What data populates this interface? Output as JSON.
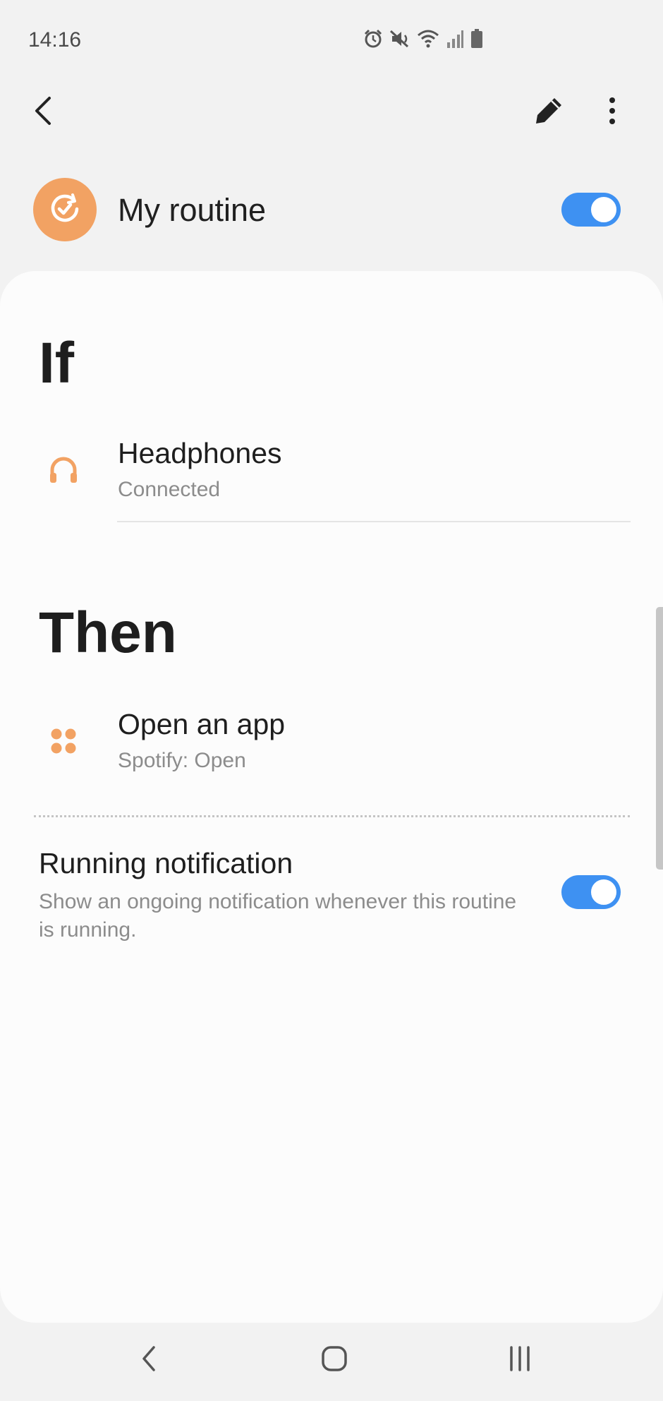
{
  "status_bar": {
    "time": "14:16",
    "icons": [
      "alarm-icon",
      "mute-icon",
      "wifi-icon",
      "signal-icon",
      "battery-icon"
    ]
  },
  "toolbar": {
    "back_icon": "chevron-left-icon",
    "edit_icon": "pencil-icon",
    "more_icon": "more-vertical-icon"
  },
  "routine": {
    "name": "My routine",
    "enabled": true,
    "icon": "routine-check-icon",
    "accent_color": "#f2a263"
  },
  "if_section": {
    "title": "If",
    "items": [
      {
        "icon": "headphones-icon",
        "title": "Headphones",
        "subtitle": "Connected"
      }
    ]
  },
  "then_section": {
    "title": "Then",
    "items": [
      {
        "icon": "apps-icon",
        "title": "Open an app",
        "subtitle": "Spotify: Open"
      }
    ]
  },
  "running_notification": {
    "title": "Running notification",
    "description": "Show an ongoing notification whenever this routine is running.",
    "enabled": true
  },
  "colors": {
    "switch_on": "#3e91f2",
    "icon_orange": "#f2a263"
  },
  "nav_bar": {
    "back_icon": "nav-back-icon",
    "home_icon": "nav-home-icon",
    "recents_icon": "nav-recents-icon"
  }
}
